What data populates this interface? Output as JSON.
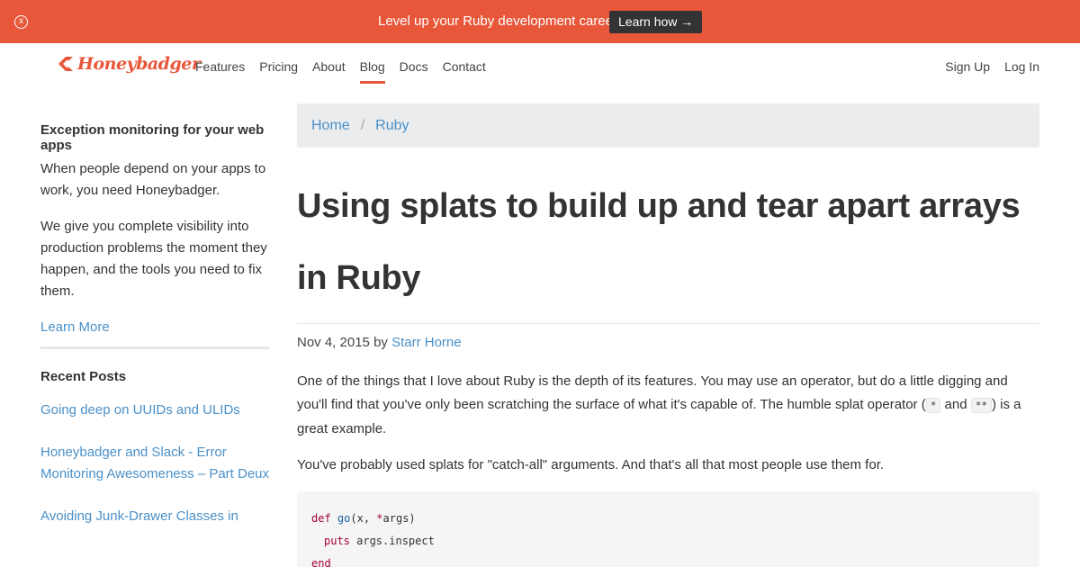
{
  "banner": {
    "close_glyph": "x",
    "text": "Level up your Ruby development career.",
    "button_label": "Learn how →",
    "bg_color": "#e8573a"
  },
  "nav": {
    "logo_text": "Honeybadger",
    "links": [
      "Features",
      "Pricing",
      "About",
      "Blog",
      "Docs",
      "Contact"
    ],
    "active": "Blog",
    "right_links": [
      "Sign Up",
      "Log In"
    ]
  },
  "sidebar": {
    "title": "Exception monitoring for your web apps",
    "p1": "When people depend on your apps to work, you need Honeybadger.",
    "p2": "We give you complete visibility into production problems the moment they happen, and the tools you need to fix them.",
    "learn_more": "Learn More",
    "recent_title": "Recent Posts",
    "recent_posts": [
      "Going deep on UUIDs and ULIDs",
      "Honeybadger and Slack - Error Monitoring Awesomeness – Part Deux",
      "Avoiding Junk-Drawer Classes in"
    ]
  },
  "breadcrumb": {
    "items": [
      "Home",
      "Ruby"
    ],
    "separator": "/"
  },
  "post": {
    "title": "Using splats to build up and tear apart arrays in Ruby",
    "date": "Nov 4, 2015",
    "by": "by",
    "author": "Starr Horne",
    "p1_a": "One of the things that I love about Ruby is the depth of its features. You may use an operator, but do a little digging and you'll find that you've only been scratching the surface of what it's capable of. The humble splat operator (",
    "code1": "*",
    "p1_and": "and",
    "code2": "**",
    "p1_b": ") is a great example.",
    "p2": "You've probably used splats for \"catch-all\" arguments. And that's all that most people use them for.",
    "code": {
      "def": "def",
      "fn": "go",
      "args_open": "(x, ",
      "splat": "*",
      "args_close": "args)",
      "puts": "puts",
      "puts_arg": " args.inspect",
      "end": "end"
    }
  },
  "colors": {
    "accent": "#e8573a",
    "link": "#4a90c8"
  }
}
